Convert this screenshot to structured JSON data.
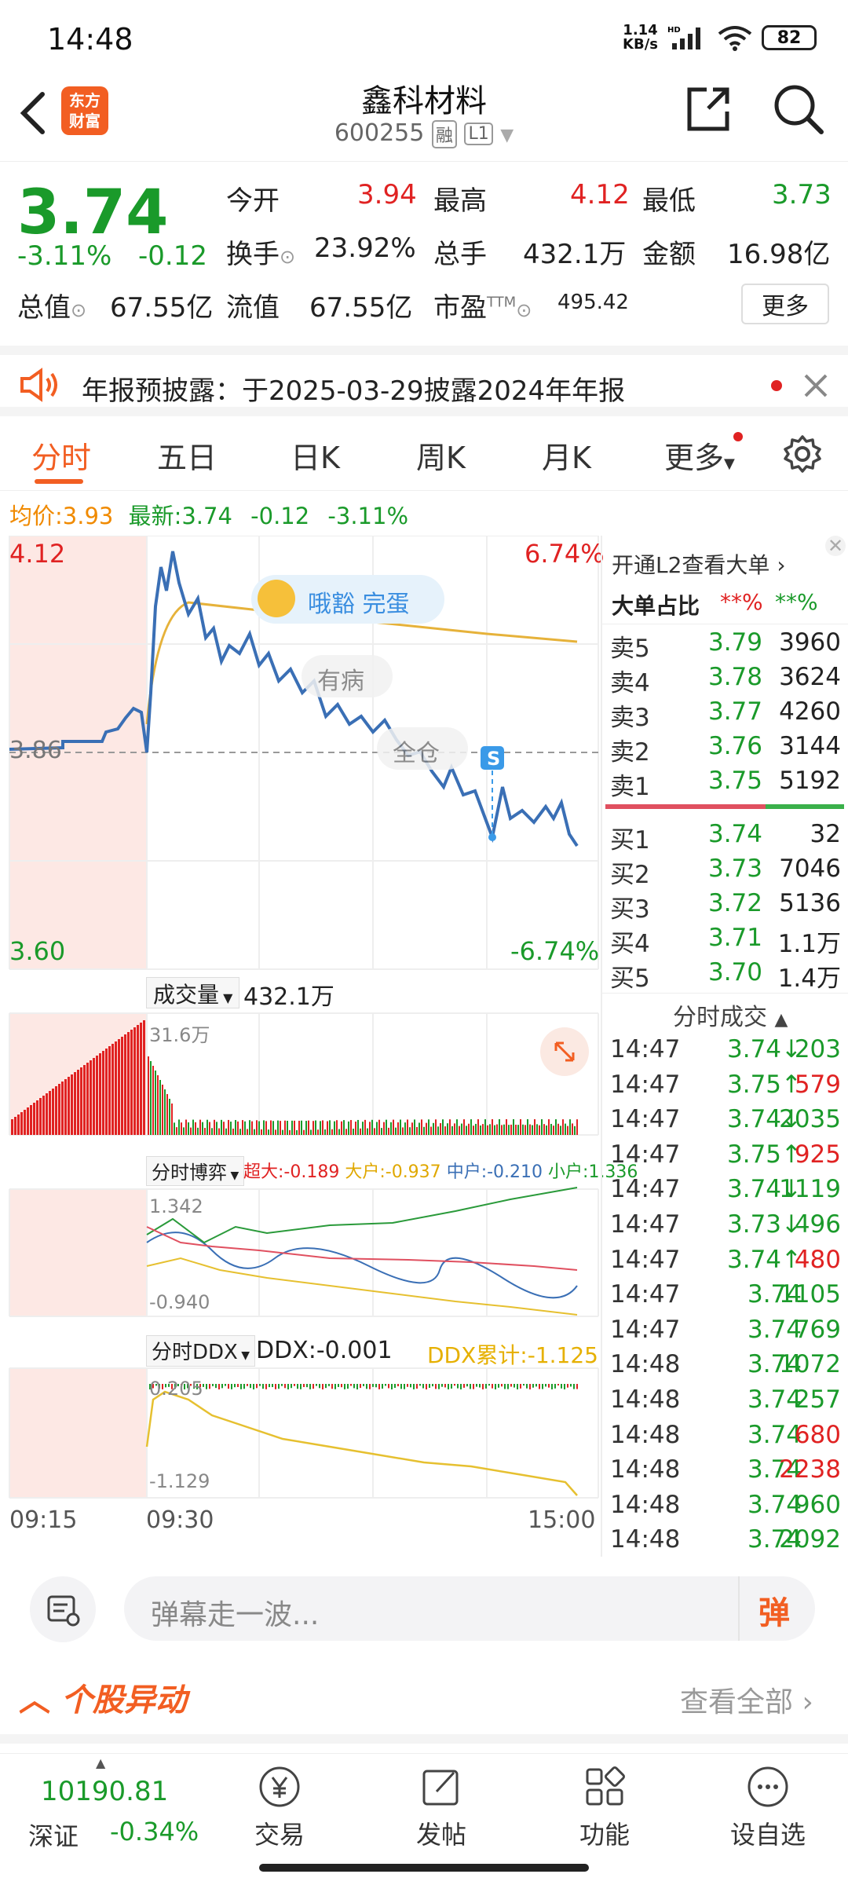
{
  "status": {
    "time": "14:48",
    "net_speed_top": "1.14",
    "net_speed_bottom": "KB/s",
    "battery": "82"
  },
  "header": {
    "logo_line1": "东方",
    "logo_line2": "财富",
    "stock_name": "鑫科材料",
    "stock_code": "600255",
    "tag1": "融",
    "tag2": "L1"
  },
  "quote": {
    "price": "3.74",
    "change_pct": "-3.11%",
    "change": "-0.12",
    "open_label": "今开",
    "open": "3.94",
    "high_label": "最高",
    "high": "4.12",
    "low_label": "最低",
    "low": "3.73",
    "turnover_label": "换手",
    "turnover": "23.92%",
    "volume_label": "总手",
    "volume": "432.1万",
    "amount_label": "金额",
    "amount": "16.98亿",
    "mktcap_label": "总值",
    "mktcap": "67.55亿",
    "float_label": "流值",
    "float": "67.55亿",
    "pe_label": "市盈",
    "pe_sup": "TTM",
    "pe": "495.42",
    "more": "更多"
  },
  "notice": {
    "text": "年报预披露：于2025-03-29披露2024年年报"
  },
  "tabs": [
    "分时",
    "五日",
    "日K",
    "周K",
    "月K",
    "更多"
  ],
  "avg_bar": {
    "avg_label": "均价:",
    "avg": "3.93",
    "latest_label": "最新:",
    "latest": "3.74",
    "change": "-0.12",
    "pct": "-3.11%"
  },
  "main_chart": {
    "y_top": "4.12",
    "y_mid": "3.86",
    "y_bottom": "3.60",
    "pct_top": "6.74%",
    "pct_bottom": "-6.74%",
    "badge_text": "哦豁 完蛋",
    "comment1": "有病",
    "comment2": "全仓",
    "signal": "S"
  },
  "volume_panel": {
    "label": "成交量",
    "value": "432.1万",
    "max": "31.6万"
  },
  "game_panel": {
    "label": "分时博弈",
    "super": "超大:-0.189",
    "big": "大户:-0.937",
    "mid": "中户:-0.210",
    "small": "小户:1.336",
    "max": "1.342",
    "min": "-0.940"
  },
  "ddx_panel": {
    "label": "分时DDX",
    "ddx": "DDX:-0.001",
    "ddx_cum": "DDX累计:-1.125",
    "max": "0.205",
    "min": "-1.129"
  },
  "time_axis": [
    "09:15",
    "09:30",
    "15:00"
  ],
  "book": {
    "l2_link": "开通L2查看大单",
    "ratio_label": "大单占比",
    "ratio_red": "**%",
    "ratio_green": "**%",
    "asks": [
      {
        "label": "卖5",
        "price": "3.79",
        "vol": "3960"
      },
      {
        "label": "卖4",
        "price": "3.78",
        "vol": "3624"
      },
      {
        "label": "卖3",
        "price": "3.77",
        "vol": "4260"
      },
      {
        "label": "卖2",
        "price": "3.76",
        "vol": "3144"
      },
      {
        "label": "卖1",
        "price": "3.75",
        "vol": "5192"
      }
    ],
    "bids": [
      {
        "label": "买1",
        "price": "3.74",
        "vol": "32"
      },
      {
        "label": "买2",
        "price": "3.73",
        "vol": "7046"
      },
      {
        "label": "买3",
        "price": "3.72",
        "vol": "5136"
      },
      {
        "label": "买4",
        "price": "3.71",
        "vol": "1.1万"
      },
      {
        "label": "买5",
        "price": "3.70",
        "vol": "1.4万"
      }
    ],
    "ticks_label": "分时成交",
    "ticks": [
      {
        "t": "14:47",
        "p": "3.74↓",
        "v": "203",
        "c": "green"
      },
      {
        "t": "14:47",
        "p": "3.75↑",
        "v": "579",
        "c": "red"
      },
      {
        "t": "14:47",
        "p": "3.74↓",
        "v": "2035",
        "c": "green"
      },
      {
        "t": "14:47",
        "p": "3.75↑",
        "v": "925",
        "c": "red"
      },
      {
        "t": "14:47",
        "p": "3.74↓",
        "v": "1119",
        "c": "green"
      },
      {
        "t": "14:47",
        "p": "3.73↓",
        "v": "496",
        "c": "green"
      },
      {
        "t": "14:47",
        "p": "3.74↑",
        "v": "480",
        "c": "red"
      },
      {
        "t": "14:47",
        "p": "3.74",
        "v": "1105",
        "c": "green"
      },
      {
        "t": "14:47",
        "p": "3.74",
        "v": "769",
        "c": "green"
      },
      {
        "t": "14:48",
        "p": "3.74",
        "v": "1072",
        "c": "green"
      },
      {
        "t": "14:48",
        "p": "3.74",
        "v": "257",
        "c": "green"
      },
      {
        "t": "14:48",
        "p": "3.74",
        "v": "680",
        "c": "red"
      },
      {
        "t": "14:48",
        "p": "3.74",
        "v": "2238",
        "c": "red"
      },
      {
        "t": "14:48",
        "p": "3.74",
        "v": "960",
        "c": "green"
      },
      {
        "t": "14:48",
        "p": "3.74",
        "v": "2092",
        "c": "green"
      }
    ]
  },
  "danmu": {
    "placeholder": "弹幕走一波...",
    "button": "弹"
  },
  "movement": {
    "title": "个股异动",
    "view_all": "查看全部"
  },
  "bottom_nav": {
    "index_value": "10190.81",
    "index_name": "深证",
    "index_pct": "-0.34%",
    "items": [
      "交易",
      "发帖",
      "功能",
      "设自选"
    ]
  },
  "colors": {
    "up": "#e02222",
    "down": "#1a9a2a",
    "accent": "#f25e22",
    "price_line": "#3a6fb5",
    "avg_line": "#e6b23a"
  }
}
